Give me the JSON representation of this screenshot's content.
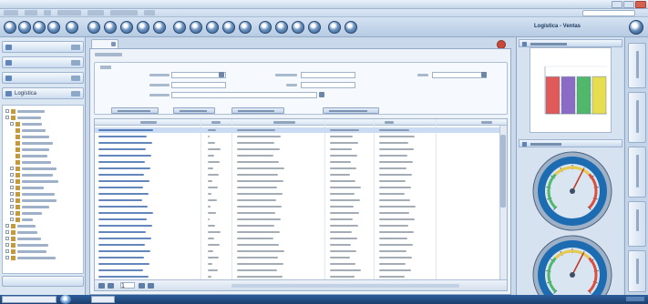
{
  "window": {
    "title": ""
  },
  "menubar": {
    "items": [
      "",
      "",
      "",
      "",
      "",
      "",
      "",
      ""
    ]
  },
  "toolbar": {
    "right_title": "Logística - Ventas"
  },
  "left_panel": {
    "sections": [
      "",
      "",
      "",
      "Logística"
    ],
    "bottom_section": ""
  },
  "document": {
    "tab_label": "",
    "caption": "",
    "filter": {
      "legend": "",
      "labels": [
        "",
        "",
        "",
        "",
        "",
        ""
      ],
      "buttons": [
        "",
        "",
        "",
        ""
      ]
    },
    "grid": {
      "columns": [
        "",
        "",
        "",
        "",
        "",
        ""
      ],
      "row_count": 24,
      "selected_row": 0,
      "pager_page": "1"
    }
  },
  "right_panel": {
    "chart_header": "",
    "gauge_header": "",
    "chart_data": {
      "type": "bar",
      "title": "",
      "categories": [
        "",
        "",
        "",
        ""
      ],
      "values": [
        78,
        78,
        78,
        78
      ],
      "colors": [
        "#e05a5a",
        "#8a6cc6",
        "#4fb86a",
        "#e6de4e"
      ],
      "ylim": [
        0,
        100
      ]
    },
    "gauges": [
      {
        "value": 60
      },
      {
        "value": 60
      }
    ]
  },
  "right_tabs": [
    "",
    "",
    "",
    "",
    ""
  ],
  "statusbar": {
    "start_label": ""
  },
  "colors": {
    "accent": "#2c5687",
    "selection": "#c9dcf3",
    "link": "#2f5fa6"
  }
}
